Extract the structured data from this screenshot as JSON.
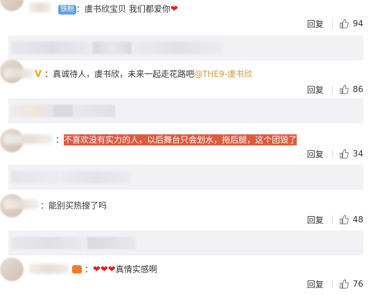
{
  "reply_label": "回复",
  "comments": [
    {
      "badge": "铁粉",
      "text": "：虞书欣宝贝   我们都爱你",
      "heart": "❤",
      "likes": "94"
    },
    {
      "verified": "V",
      "text": "：真诚待人，虞书欣，未来一起走花路吧",
      "mention": "@THE9-虞书欣",
      "likes": "86"
    },
    {
      "prefix": "：",
      "highlight": "不喜欢没有实力的人，以后舞台只会划水，拖后腿，这个团毁了",
      "likes": "34"
    },
    {
      "text": "：能别买热搜了吗",
      "likes": "48"
    },
    {
      "prefix": "：",
      "hearts": "❤❤❤",
      "suffix": "真情实感啊",
      "likes": "76"
    }
  ],
  "colors": {
    "accent_link": "#d49a3a",
    "highlight_bg": "#e2583e",
    "badge_bg": "#5ea0e6",
    "subcomment_bg": "#f2f2f5"
  }
}
